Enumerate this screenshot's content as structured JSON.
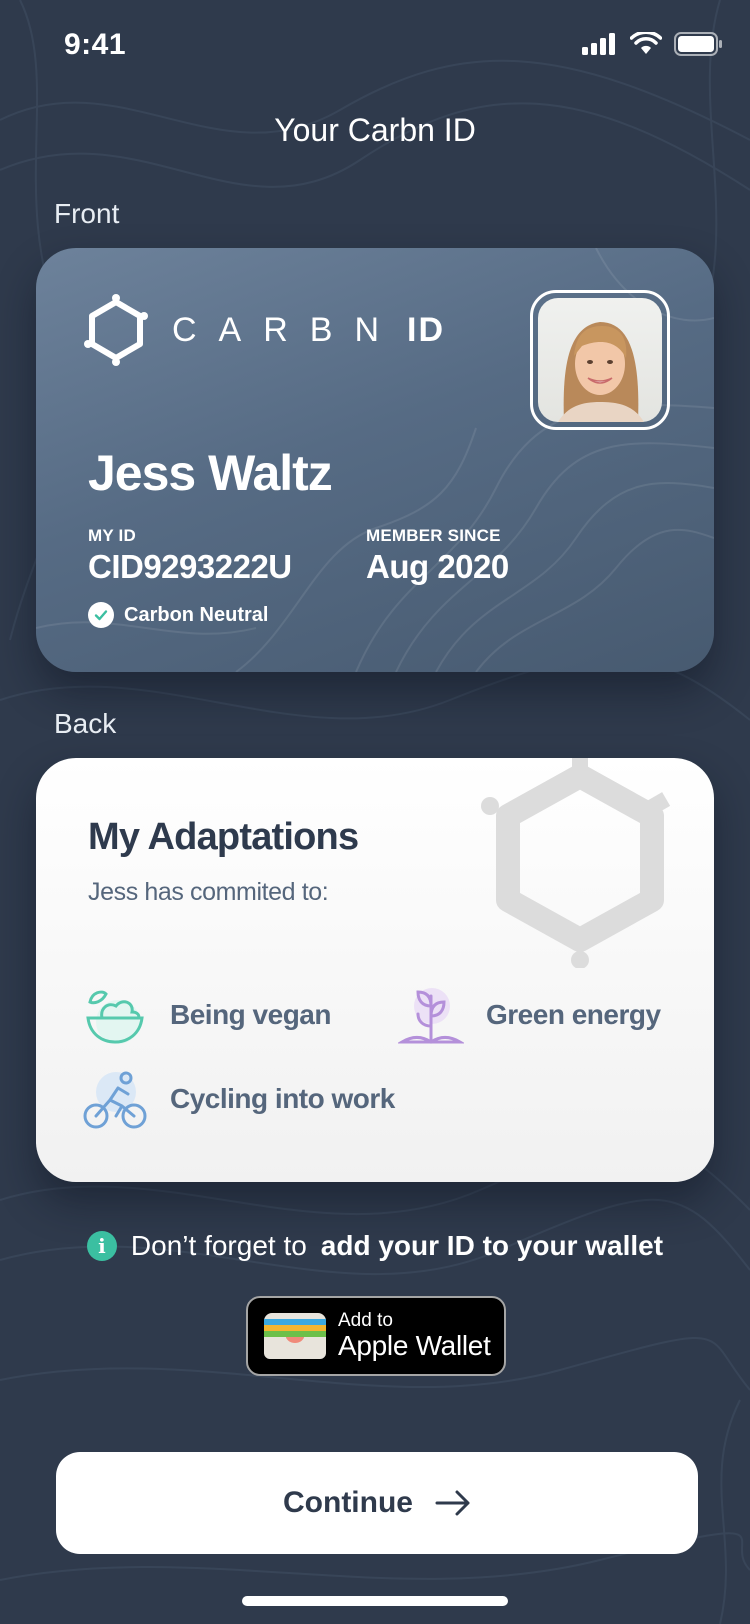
{
  "status_bar": {
    "time": "9:41"
  },
  "page": {
    "title": "Your Carbn ID"
  },
  "sections": {
    "front": "Front",
    "back": "Back"
  },
  "card_front": {
    "brand_word": "CARBN",
    "brand_suffix": "ID",
    "holder_name": "Jess Waltz",
    "my_id_label": "MY ID",
    "my_id_value": "CID9293222U",
    "member_since_label": "MEMBER SINCE",
    "member_since_value": "Aug 2020",
    "status": "Carbon Neutral"
  },
  "card_back": {
    "title": "My Adaptations",
    "subtitle": "Jess has commited to:",
    "adaptations": [
      {
        "label": "Being vegan",
        "icon": "salad-bowl-icon"
      },
      {
        "label": "Green energy",
        "icon": "sprout-icon"
      },
      {
        "label": "Cycling into work",
        "icon": "cyclist-icon"
      }
    ]
  },
  "info": {
    "prefix": "Don’t forget to",
    "emphasis": "add your ID to your wallet"
  },
  "wallet_button": {
    "small": "Add to",
    "large": "Apple Wallet"
  },
  "continue_button": {
    "label": "Continue"
  },
  "colors": {
    "background": "#2f3a4c",
    "accent": "#3bbfa1",
    "card_front": "#566b84",
    "card_back": "#ffffff"
  }
}
